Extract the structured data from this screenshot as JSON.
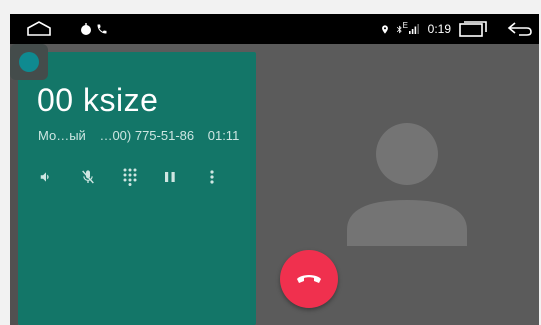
{
  "statusbar": {
    "time": "0:19",
    "signal_label": "E",
    "icons": [
      "home-icon",
      "notification-dot-icon",
      "phone-icon",
      "location-icon",
      "bluetooth-icon",
      "signal-icon",
      "recents-icon",
      "back-icon"
    ]
  },
  "call": {
    "caller_name": "00 ksize",
    "location": "Мо…ый",
    "number": "…00) 775-51-86",
    "duration": "01:11",
    "controls": [
      "speaker-icon",
      "mute-icon",
      "dialpad-icon",
      "hold-icon",
      "more-icon"
    ]
  },
  "colors": {
    "card": "#137668",
    "end_call": "#f0304e",
    "background": "#5b5b5b"
  }
}
